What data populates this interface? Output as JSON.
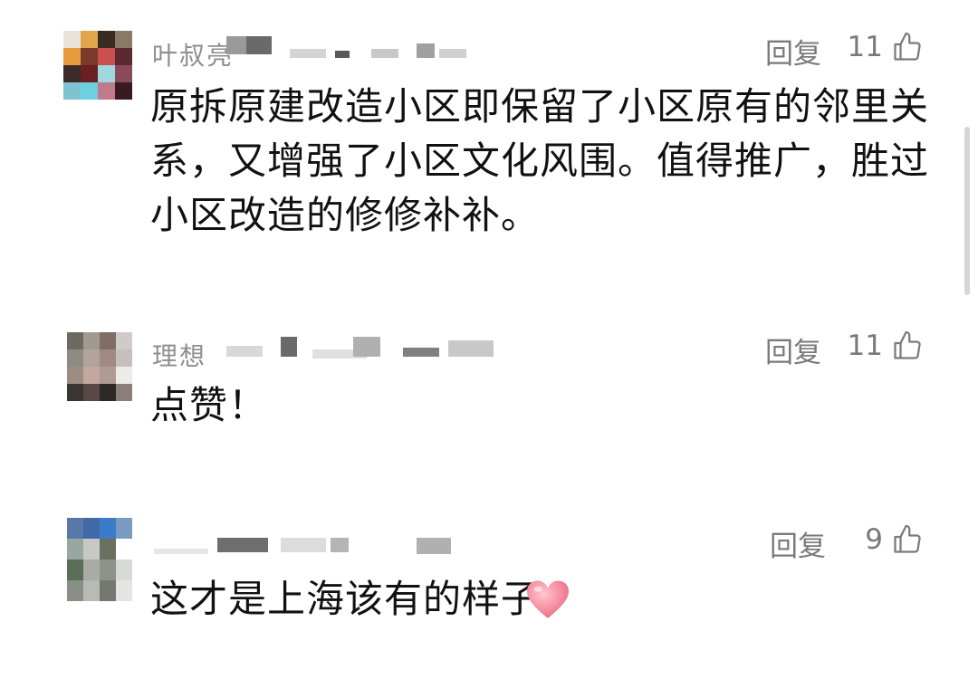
{
  "comments": [
    {
      "username": "叶叔亮",
      "reply_label": "回复",
      "like_count": "11",
      "text_lines": [
        "原拆原建改造小区即保留了小区原有的邻里关",
        "系，又增强了小区文化风围。值得推广，胜过",
        "小区改造的修修补补。"
      ],
      "avatar_colors": [
        "#e8e2da",
        "#e1a64b",
        "#3a2a20",
        "#8a7a66",
        "#e59b3c",
        "#7a3a2a",
        "#c9504f",
        "#5a2a30",
        "#3a2a28",
        "#6a1f24",
        "#9fd9df",
        "#8a4a5a",
        "#7fc3d0",
        "#6ed0de",
        "#c07a8a",
        "#3a1a22"
      ]
    },
    {
      "username": "理想",
      "reply_label": "回复",
      "like_count": "11",
      "text_lines": [
        "点赞！"
      ],
      "avatar_colors": [
        "#6a6a62",
        "#a19a91",
        "#7e6e66",
        "#d0cbc8",
        "#8f8a84",
        "#b0a49b",
        "#a08b84",
        "#c5c0bc",
        "#9c8c82",
        "#c4a8a0",
        "#b09a94",
        "#eeeae8",
        "#3a3432",
        "#5a4844",
        "#2e2826",
        "#8a7e7a"
      ]
    },
    {
      "username": "",
      "reply_label": "回复",
      "like_count": "9",
      "text_lines": [
        "这才是上海该有的样子"
      ],
      "avatar_colors": [
        "#5878a8",
        "#3f6aa6",
        "#3c7bc8",
        "#7a9ac2",
        "#9aa6a0",
        "#c7c9c6",
        "#6a7060",
        "#ffffff",
        "#5a6e58",
        "#a8aca4",
        "#8e9288",
        "#d8dad6",
        "#8a8e88",
        "#b8bab4",
        "#747870",
        "#e4e5e2"
      ]
    }
  ],
  "colors": {
    "meta_text": "#7a7a7a",
    "body_text": "#111111",
    "heart": "#f07a8a"
  }
}
